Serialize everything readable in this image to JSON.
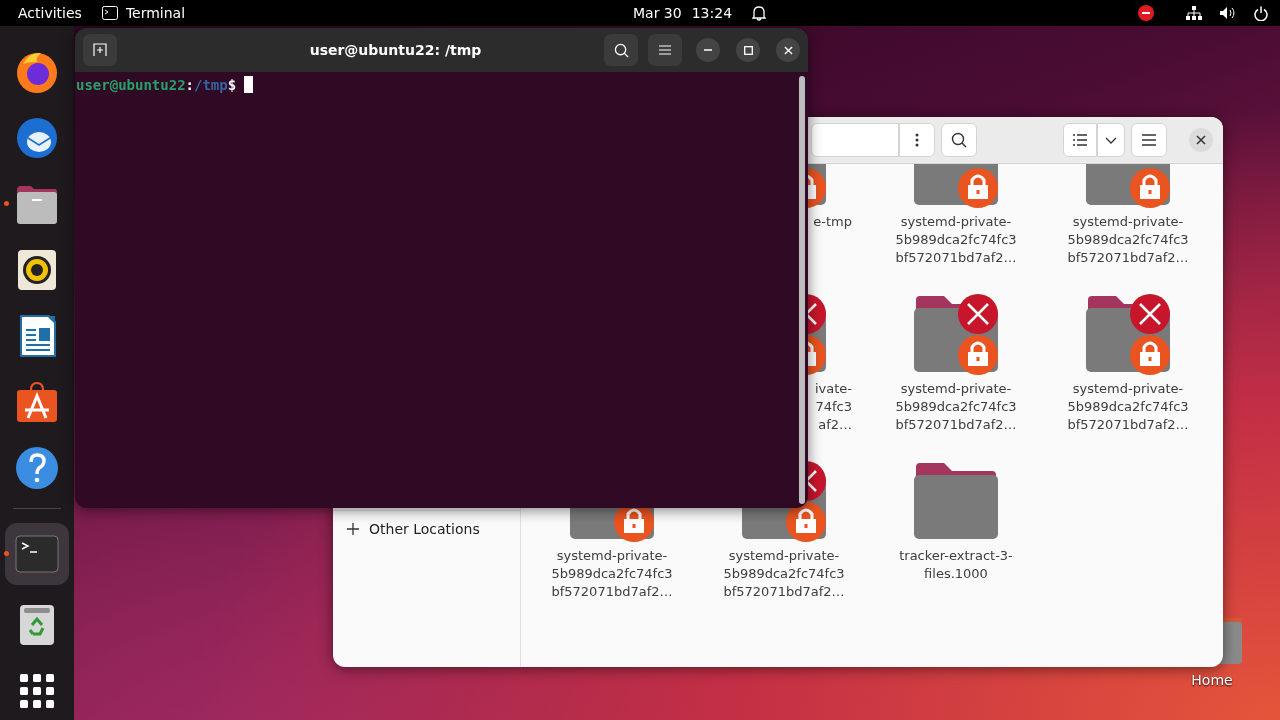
{
  "top_bar": {
    "activities": "Activities",
    "app": "Terminal",
    "date": "Mar 30",
    "time": "13:24"
  },
  "dock": [
    {
      "kind": "browser",
      "running": false,
      "focused": false
    },
    {
      "kind": "mail",
      "running": false,
      "focused": false
    },
    {
      "kind": "files",
      "running": true,
      "focused": false
    },
    {
      "kind": "music",
      "running": false,
      "focused": false
    },
    {
      "kind": "writer",
      "running": false,
      "focused": false
    },
    {
      "kind": "software",
      "running": false,
      "focused": false
    },
    {
      "kind": "help",
      "running": false,
      "focused": false
    },
    {
      "kind": "terminal",
      "running": true,
      "focused": true
    },
    {
      "kind": "trash",
      "running": false,
      "focused": false
    },
    {
      "kind": "apps",
      "running": false,
      "focused": false
    }
  ],
  "terminal": {
    "title": "user@ubuntu22: /tmp",
    "prompt": {
      "user_host": "user@ubuntu22",
      "separator": ":",
      "path": "/tmp",
      "symbol": "$"
    }
  },
  "files": {
    "sidebar": [
      {
        "label": "Other Locations"
      }
    ],
    "items": [
      {
        "kind": "partial",
        "label": [
          "e-tmp"
        ],
        "locked": true,
        "unreadable": false
      },
      {
        "kind": "full",
        "label": [
          "systemd-private-",
          "5b989dca2fc74fc3",
          "bf572071bd7af2…"
        ],
        "locked": true,
        "unreadable": false
      },
      {
        "kind": "full",
        "label": [
          "systemd-private-",
          "5b989dca2fc74fc3",
          "bf572071bd7af2…"
        ],
        "locked": true,
        "unreadable": false
      },
      {
        "kind": "partial",
        "label": [
          "ivate-",
          "74fc3",
          "af2…"
        ],
        "locked": true,
        "unreadable": true
      },
      {
        "kind": "full",
        "label": [
          "systemd-private-",
          "5b989dca2fc74fc3",
          "bf572071bd7af2…"
        ],
        "locked": true,
        "unreadable": true
      },
      {
        "kind": "full",
        "label": [
          "systemd-private-",
          "5b989dca2fc74fc3",
          "bf572071bd7af2…"
        ],
        "locked": true,
        "unreadable": true
      },
      {
        "kind": "full",
        "label": [
          "systemd-private-",
          "5b989dca2fc74fc3",
          "bf572071bd7af2…"
        ],
        "locked": true,
        "unreadable": false
      },
      {
        "kind": "full",
        "label": [
          "systemd-private-",
          "5b989dca2fc74fc3",
          "bf572071bd7af2…"
        ],
        "locked": true,
        "unreadable": true
      },
      {
        "kind": "full",
        "label": [
          "tracker-extract-3-",
          "files.1000"
        ],
        "locked": false,
        "unreadable": false
      }
    ]
  },
  "desktop_icons": [
    {
      "label": "Home"
    }
  ]
}
